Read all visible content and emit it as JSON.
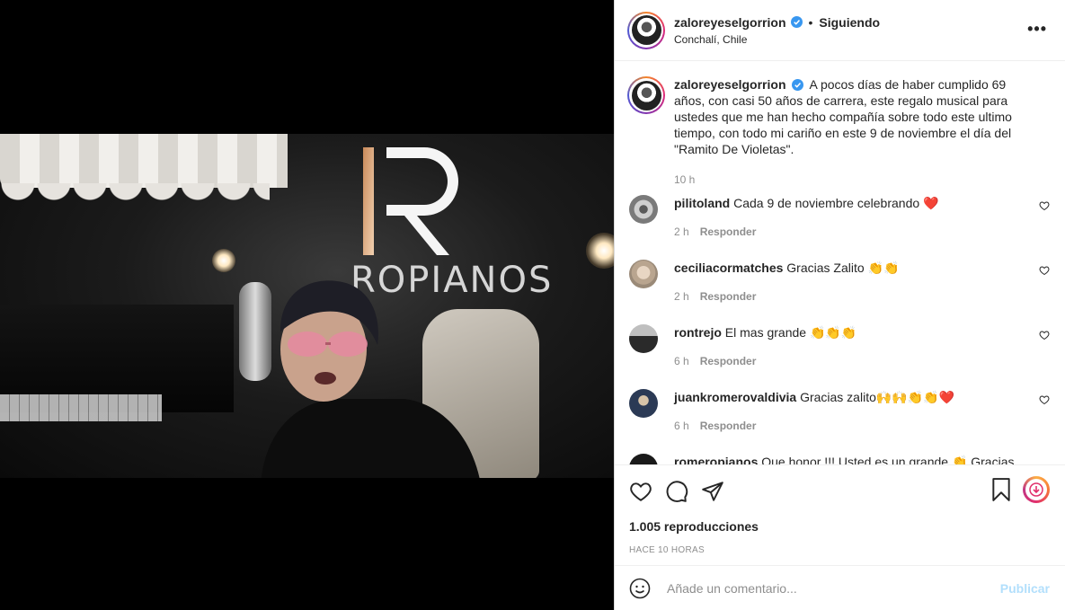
{
  "post": {
    "username": "zaloreyeselgorrion",
    "follow_status": "Siguiendo",
    "separator": "•",
    "location": "Conchalí, Chile",
    "more": "•••",
    "caption": "A pocos días de haber cumplido 69 años, con casi 50 años de carrera, este regalo musical para ustedes que me han hecho compañía sobre todo este ultimo tiempo, con todo mi cariño en este 9 de noviembre el día del \"Ramito De Violetas\".",
    "caption_time": "10 h"
  },
  "video": {
    "brand_text": "ROPIANOS"
  },
  "comments": [
    {
      "user": "pilitoland",
      "text": "Cada 9 de noviembre celebrando ❤️",
      "time": "2 h",
      "reply": "Responder"
    },
    {
      "user": "ceciliacormatches",
      "text": "Gracias Zalito 👏👏",
      "time": "2 h",
      "reply": "Responder"
    },
    {
      "user": "rontrejo",
      "text": "El mas grande 👏👏👏",
      "time": "6 h",
      "reply": "Responder"
    },
    {
      "user": "juankromerovaldivia",
      "text": "Gracias zalito🙌🙌👏👏❤️",
      "time": "6 h",
      "reply": "Responder"
    },
    {
      "user": "romeropianos",
      "text": "Que honor !!! Usted es un grande 👏 Gracias",
      "time": "",
      "reply": ""
    }
  ],
  "stats": {
    "views": "1.005 reproducciones",
    "ago": "HACE 10 HORAS"
  },
  "composer": {
    "placeholder": "Añade un comentario...",
    "publish": "Publicar"
  },
  "colors": {
    "verified": "#3897f0",
    "heart": "#ed4956",
    "publish_disabled": "#b2dffc"
  }
}
